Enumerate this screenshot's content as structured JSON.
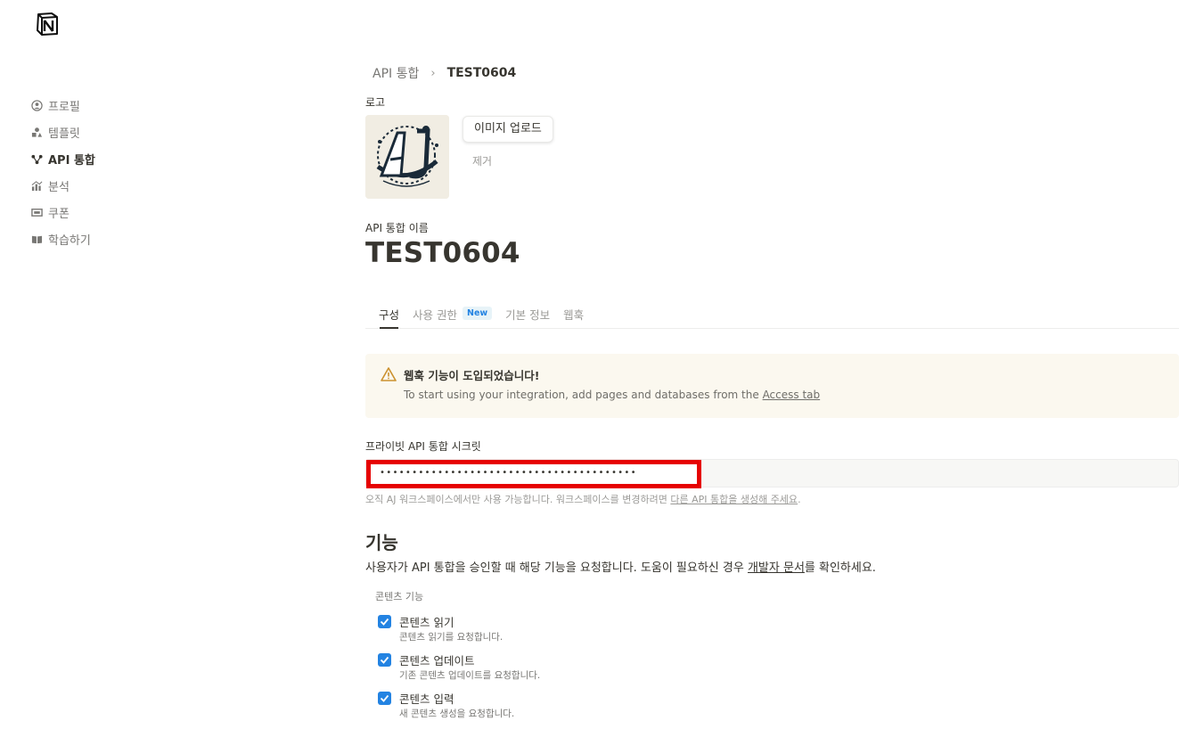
{
  "sidebar": {
    "items": [
      {
        "label": "프로필",
        "icon": "profile-icon",
        "active": false
      },
      {
        "label": "템플릿",
        "icon": "template-icon",
        "active": false
      },
      {
        "label": "API 통합",
        "icon": "integration-icon",
        "active": true
      },
      {
        "label": "분석",
        "icon": "analytics-icon",
        "active": false
      },
      {
        "label": "쿠폰",
        "icon": "coupon-icon",
        "active": false
      },
      {
        "label": "학습하기",
        "icon": "book-icon",
        "active": false
      }
    ]
  },
  "breadcrumb": {
    "parent": "API 통합",
    "separator": "›",
    "current": "TEST0604"
  },
  "logo_section": {
    "label": "로고",
    "upload_label": "이미지 업로드",
    "remove_label": "제거"
  },
  "name_section": {
    "label": "API 통합 이름",
    "title": "TEST0604"
  },
  "tabs": [
    {
      "label": "구성",
      "active": true
    },
    {
      "label": "사용 권한",
      "badge": "New"
    },
    {
      "label": "기본 정보"
    },
    {
      "label": "웹훅"
    }
  ],
  "alert": {
    "title": "웹훅 기능이 도입되었습니다!",
    "body": "To start using your integration, add pages and databases from the ",
    "link": "Access tab"
  },
  "secret": {
    "label": "프라이빗 API 통합 시크릿",
    "masked_value": "••••••••••••••••••••••••••••••••••••••••",
    "note_prefix": "오직 AJ 워크스페이스에서만 사용 가능합니다. 워크스페이스를 변경하려면 ",
    "note_link": "다른 API 통합을 생성해 주세요",
    "note_suffix": "."
  },
  "features": {
    "heading": "기능",
    "desc_prefix": "사용자가 API 통합을 승인할 때 해당 기능을 요청합니다. 도움이 필요하신 경우 ",
    "desc_link": "개발자 문서",
    "desc_suffix": "를 확인하세요.",
    "group_label": "콘텐츠 기능",
    "items": [
      {
        "title": "콘텐츠 읽기",
        "desc": "콘텐츠 읽기를 요청합니다.",
        "checked": true
      },
      {
        "title": "콘텐츠 업데이트",
        "desc": "기존 콘텐츠 업데이트를 요청합니다.",
        "checked": true
      },
      {
        "title": "콘텐츠 입력",
        "desc": "새 콘텐츠 생성을 요청합니다.",
        "checked": true
      }
    ]
  },
  "colors": {
    "accent": "#2383e2",
    "alert_bg": "#fbf8ef",
    "mask_border": "#e60000"
  }
}
